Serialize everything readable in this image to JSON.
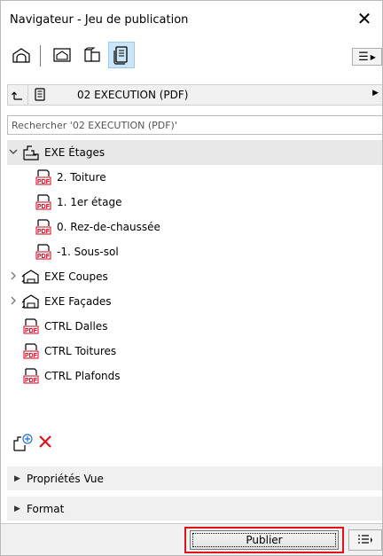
{
  "window": {
    "title": "Navigateur - Jeu de publication",
    "close_glyph": "✕"
  },
  "toolbar": {
    "buttons": [
      {
        "icon": "project-map-icon",
        "active": false
      },
      {
        "icon": "view-map-icon",
        "active": false
      },
      {
        "icon": "layout-book-icon",
        "active": false
      },
      {
        "icon": "publisher-sets-icon",
        "active": true
      }
    ],
    "menu_glyph": "☰"
  },
  "set_selector": {
    "label": "02 EXECUTION (PDF)"
  },
  "search": {
    "placeholder": "Rechercher '02 EXECUTION (PDF)'"
  },
  "tree": {
    "folder_exe_etages": {
      "label": "EXE Étages",
      "expanded": true
    },
    "items": [
      {
        "label": "2. Toiture"
      },
      {
        "label": "1. 1er étage"
      },
      {
        "label": "0. Rez-de-chaussée"
      },
      {
        "label": "-1. Sous-sol"
      }
    ],
    "folder_exe_coupes": {
      "label": "EXE Coupes",
      "expanded": false
    },
    "folder_exe_facades": {
      "label": "EXE Façades",
      "expanded": false
    },
    "ctrl_items": [
      {
        "label": "CTRL Dalles"
      },
      {
        "label": "CTRL Toitures"
      },
      {
        "label": "CTRL Plafonds"
      }
    ]
  },
  "sections": {
    "properties": "Propriétés Vue",
    "format": "Format"
  },
  "footer": {
    "publish_label": "Publier"
  },
  "colors": {
    "highlight": "#e2121a",
    "active_button": "#cce4f7",
    "pdf_red": "#d0021b"
  }
}
